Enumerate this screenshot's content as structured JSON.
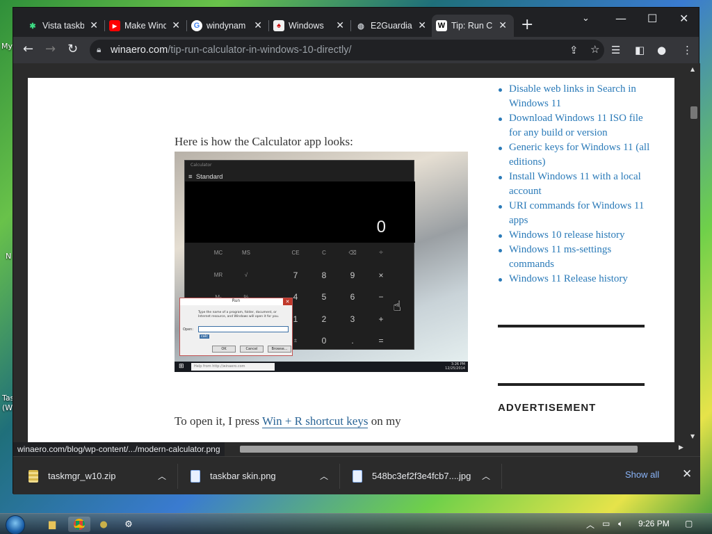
{
  "desktop": {
    "fragment_my": "My",
    "fragment_n": "N",
    "fragment_tas": "Tas",
    "fragment_w": "(W"
  },
  "tabs": [
    {
      "title": "Vista taskb",
      "favicon": "vista-favicon",
      "active": false
    },
    {
      "title": "Make Wind",
      "favicon": "youtube-favicon",
      "active": false
    },
    {
      "title": "windynam",
      "favicon": "google-favicon",
      "active": false
    },
    {
      "title": "Windows",
      "favicon": "windows-favicon",
      "active": false
    },
    {
      "title": "E2Guardia",
      "favicon": "globe-favicon",
      "active": false
    },
    {
      "title": "Tip: Run C",
      "favicon": "winaero-favicon",
      "active": true
    }
  ],
  "toolbar": {
    "url_domain": "winaero.com",
    "url_path": "/tip-run-calculator-in-windows-10-directly/"
  },
  "article": {
    "intro": "Here is how the Calculator app looks:",
    "body_before": "To open it, I press ",
    "body_link": "Win + R shortcut keys",
    "body_after": " on my"
  },
  "calculator": {
    "mode": "Standard",
    "display": "0",
    "keys_row1": [
      "MC",
      "MS",
      "CE",
      "C",
      "⌫",
      "÷"
    ],
    "keys_row2": [
      "MR",
      "√",
      "7",
      "8",
      "9",
      "×"
    ],
    "keys_row3": [
      "M-",
      "%",
      "4",
      "5",
      "6",
      "−"
    ],
    "keys_row4": [
      "",
      "",
      "1",
      "2",
      "3",
      "+"
    ],
    "keys_row5": [
      "",
      "±",
      "",
      "0",
      ".",
      "="
    ]
  },
  "run_dialog": {
    "title": "Run",
    "text": "Type the name of a program, folder, document, or Internet resource, and Windows will open it for you.",
    "open_label": "Open:",
    "value": "calc",
    "ok": "OK",
    "cancel": "Cancel",
    "browse": "Browse..."
  },
  "embedded_taskbar": {
    "search": "Help from http://winaero.com",
    "time": "3:26 PM",
    "date": "12/25/2014"
  },
  "sidebar": {
    "links": [
      "Disable web links in Search in Windows 11",
      "Download Windows 11 ISO file for any build or version",
      "Generic keys for Windows 11 (all editions)",
      "Install Windows 11 with a local account",
      "URI commands for Windows 11 apps",
      "Windows 10 release history",
      "Windows 11 ms-settings commands",
      "Windows 11 Release history"
    ],
    "ad_heading": "ADVERTISEMENT"
  },
  "status_url": "winaero.com/blog/wp-content/.../modern-calculator.png",
  "downloads": [
    {
      "name": "taskmgr_w10.zip",
      "icon": "zip-file-icon"
    },
    {
      "name": "taskbar skin.png",
      "icon": "image-file-icon"
    },
    {
      "name": "548bc3ef2f3e4fcb7....jpg",
      "icon": "image-file-icon"
    }
  ],
  "show_all": "Show all",
  "taskbar": {
    "time": "9:26 PM"
  }
}
